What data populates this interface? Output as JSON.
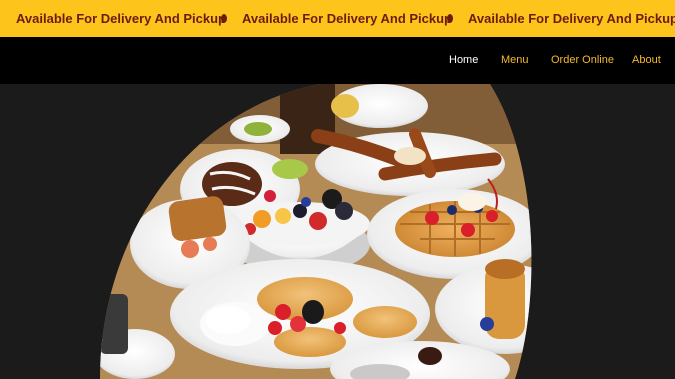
{
  "announcement_bar": {
    "message": "Available For Delivery And Pickup",
    "text_color": "#6b1d0d",
    "background": "#fdc41b"
  },
  "nav": {
    "items": [
      {
        "label": "Home"
      },
      {
        "label": "Menu"
      },
      {
        "label": "Order Online"
      },
      {
        "label": "About"
      }
    ],
    "active_color": "#ffffff",
    "link_color": "#f5b82e"
  },
  "hero": {
    "image_subject": "breakfast spread: waffles with strawberries, pancakes with whipped cream, churros, fruit bowl, french toast"
  }
}
